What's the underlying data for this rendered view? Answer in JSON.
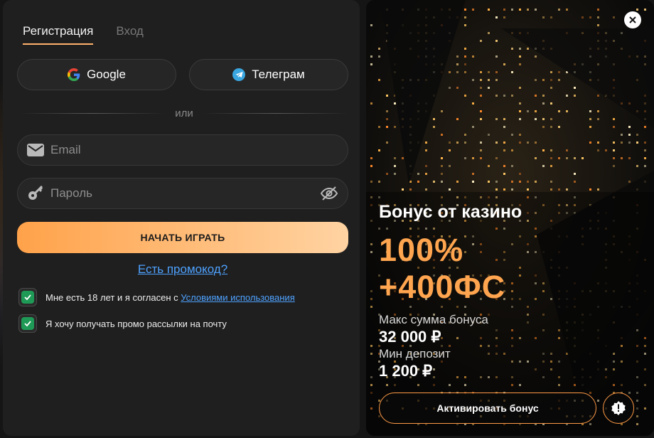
{
  "tabs": [
    {
      "label": "Регистрация",
      "active": true
    },
    {
      "label": "Вход",
      "active": false
    }
  ],
  "social": {
    "google_label": "Google",
    "telegram_label": "Телеграм"
  },
  "divider_text": "или",
  "email": {
    "placeholder": "Email",
    "value": ""
  },
  "password": {
    "placeholder": "Пароль",
    "value": ""
  },
  "play_button": "НАЧАТЬ ИГРАТЬ",
  "promo_link": "Есть промокод?",
  "checkboxes": [
    {
      "text": "Мне есть 18 лет и я согласен с ",
      "link": "Условиями использования",
      "checked": true
    },
    {
      "text": "Я хочу получать промо рассылки на почту",
      "checked": true
    }
  ],
  "bonus": {
    "title": "Бонус от казино",
    "line1": "100%",
    "line2": "+400ФС",
    "max_label": "Макс сумма бонуса",
    "max_value": "32 000 ₽",
    "min_label": "Мин депозит",
    "min_value": "1 200 ₽",
    "activate_label": "Активировать бонус"
  },
  "colors": {
    "accent": "#ffa54f",
    "link": "#4ea2ff",
    "checkbox": "#1f9a56"
  },
  "icons": [
    "google-icon",
    "telegram-icon",
    "mail-icon",
    "key-icon",
    "eye-off-icon",
    "check-icon",
    "close-icon",
    "info-icon"
  ]
}
